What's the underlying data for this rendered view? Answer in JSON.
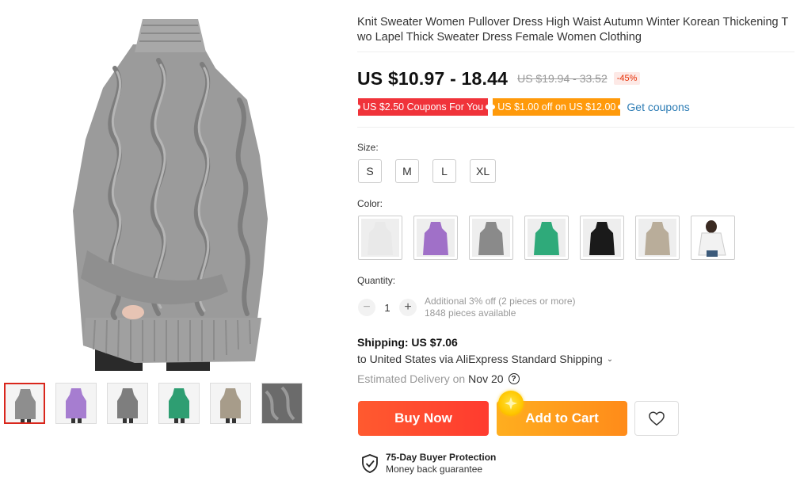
{
  "product": {
    "title": "Knit Sweater Women Pullover Dress High Waist Autumn Winter Korean Thickening Two Lapel Thick Sweater Dress Female Women Clothing",
    "price": "US $10.97 - 18.44",
    "original_price": "US $19.94 - 33.52",
    "discount": "-45%"
  },
  "coupons": {
    "items": [
      "US $2.50 Coupons For You",
      "US $1.00 off on US $12.00"
    ],
    "get_label": "Get coupons"
  },
  "size": {
    "label": "Size:",
    "options": [
      "S",
      "M",
      "L",
      "XL"
    ]
  },
  "color": {
    "label": "Color:",
    "swatches": [
      "white",
      "purple",
      "gray",
      "green",
      "black",
      "khaki",
      "white-model"
    ],
    "swatch_colors": [
      "#e9e9e9",
      "#a070c8",
      "#8a8a8a",
      "#2faa7a",
      "#1a1a1a",
      "#b9ad9a",
      "#f4f4f4"
    ]
  },
  "quantity": {
    "label": "Quantity:",
    "value": "1",
    "minus": "−",
    "plus": "+",
    "promo": "Additional 3% off (2 pieces or more)",
    "available": "1848 pieces available"
  },
  "shipping": {
    "title": "Shipping: US $7.06",
    "route": "to United States via AliExpress Standard Shipping",
    "delivery_label": "Estimated Delivery on",
    "delivery_date": "Nov 20",
    "help": "?"
  },
  "actions": {
    "buy_now": "Buy Now",
    "add_to_cart": "Add to Cart"
  },
  "protection": {
    "title": "75-Day Buyer Protection",
    "subtitle": "Money back guarantee"
  },
  "gallery": {
    "thumb_colors": [
      "#8e8e8e",
      "#a67dd0",
      "#7e7e7e",
      "#2e9e72",
      "#a79c8a",
      "#6b6b6b"
    ],
    "main_color": "#9a9a9a"
  },
  "colors": {
    "accent_red": "#ff4b2b",
    "accent_orange": "#ff9a1c",
    "link_blue": "#2e7db5"
  }
}
